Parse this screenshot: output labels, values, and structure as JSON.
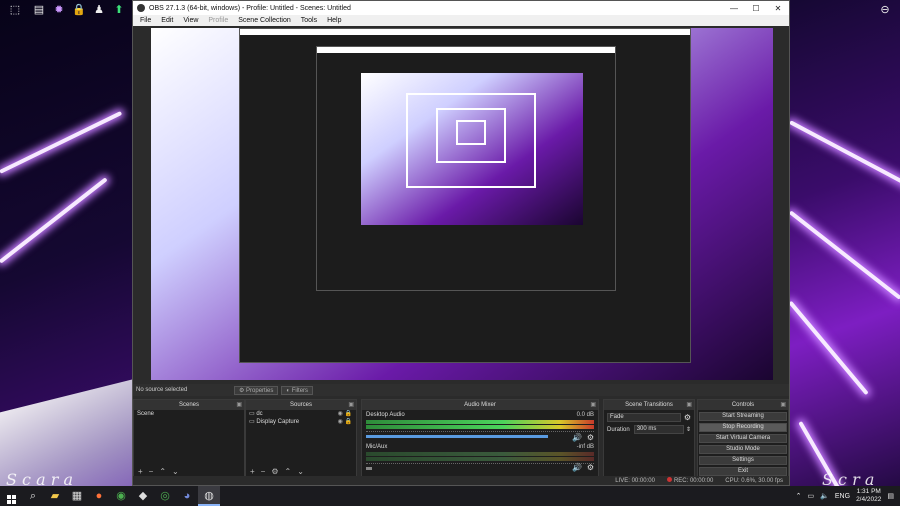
{
  "window": {
    "title": "OBS 27.1.3 (64-bit, windows) - Profile: Untitled - Scenes: Untitled",
    "menu": [
      "File",
      "Edit",
      "View",
      "Profile",
      "Scene Collection",
      "Tools",
      "Help"
    ],
    "disabled_menu": [
      "Profile"
    ]
  },
  "sourcebar": {
    "no_source": "No source selected",
    "properties": "Properties",
    "filters": "Filters"
  },
  "docks": {
    "scenes": {
      "title": "Scenes",
      "items": [
        "Scene"
      ]
    },
    "sources": {
      "title": "Sources",
      "items": [
        "dc",
        "Display Capture"
      ]
    },
    "mixer": {
      "title": "Audio Mixer",
      "channels": [
        {
          "name": "Desktop Audio",
          "db": "0.0 dB"
        },
        {
          "name": "Mic/Aux",
          "db": "-inf dB"
        }
      ]
    },
    "transitions": {
      "title": "Scene Transitions",
      "selected": "Fade",
      "duration_label": "Duration",
      "duration_value": "300 ms"
    },
    "controls": {
      "title": "Controls",
      "buttons": [
        "Start Streaming",
        "Stop Recording",
        "Start Virtual Camera",
        "Studio Mode",
        "Settings",
        "Exit"
      ],
      "active": "Stop Recording"
    }
  },
  "status": {
    "live": "LIVE: 00:00:00",
    "rec": "REC: 00:00:00",
    "cpu": "CPU: 0.6%, 30.00 fps"
  },
  "taskbar": {
    "lang": "ENG",
    "time": "1:31 PM",
    "date": "2/4/2022"
  },
  "colors": {
    "accent": "#5a9be0",
    "recording": "#cc3333",
    "meter_green": "#4bd25b"
  }
}
